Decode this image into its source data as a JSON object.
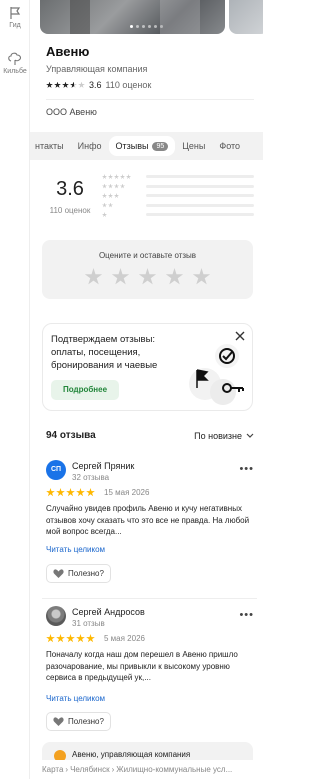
{
  "rail": {
    "items": [
      {
        "label": "Гид",
        "icon": "flag-icon"
      },
      {
        "label": "Кильбе",
        "icon": "tree-icon"
      }
    ]
  },
  "place": {
    "name": "Авеню",
    "category": "Управляющая компания",
    "rating": "3.6",
    "ratings_count": "110 оценок",
    "owner": "ООО Авеню"
  },
  "tabs": [
    {
      "label": "нтакты"
    },
    {
      "label": "Инфо"
    },
    {
      "label": "Отзывы",
      "badge": "95",
      "active": true
    },
    {
      "label": "Цены"
    },
    {
      "label": "Фото"
    }
  ],
  "summary": {
    "rating": "3.6",
    "count": "110 оценок",
    "rate_prompt": "Оцените и оставьте отзыв"
  },
  "promo": {
    "text": "Подтверждаем отзывы: оплаты, посещения, бронирования и чаевые",
    "button": "Подробнее"
  },
  "reviews_header": {
    "count": "94 отзыва",
    "sort": "По новизне"
  },
  "reviews": [
    {
      "initials": "СП",
      "name": "Сергей Пряник",
      "sub": "32 отзыва",
      "date": "15 мая 2026",
      "rating": 5,
      "text": "Случайно увидев профиль Авеню и кучу негативных отзывов хочу сказать что это все не правда. На любой мой вопрос всегда...",
      "more": "Читать целиком",
      "useful": "Полезно?"
    },
    {
      "initials": "",
      "name": "Сергей Андросов",
      "sub": "31 отзыв",
      "date": "5 мая 2026",
      "rating": 5,
      "text": "Поначалу когда наш дом перешел в Авеню пришло разочарование, мы привыкли к высокому уровню сервиса в предыдущей ук,...",
      "more": "Читать целиком",
      "useful": "Полезно?"
    }
  ],
  "next_card": {
    "title": "Авеню, управляющая компания"
  },
  "footer": {
    "crumbs": [
      "Карта",
      "Челябинск",
      "Жилищно-коммунальные усл..."
    ]
  },
  "colors": {
    "accent": "#ffb800",
    "link": "#1a66cc",
    "promo_button": "#22863a",
    "avatar": "#1a73e8"
  }
}
